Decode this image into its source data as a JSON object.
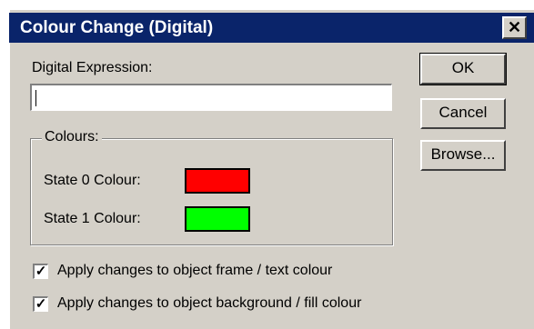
{
  "dialog": {
    "title": "Colour Change (Digital)",
    "close_glyph": "✕",
    "expression_label": "Digital Expression:",
    "expression_value": "",
    "group_label": "Colours:",
    "state0_label": "State 0 Colour:",
    "state0_color": "#ff0000",
    "state1_label": "State 1 Colour:",
    "state1_color": "#00ff00",
    "ok_label": "OK",
    "cancel_label": "Cancel",
    "browse_label": "Browse...",
    "checkbox1_label": "Apply changes to object frame / text colour",
    "checkbox1_checked": true,
    "checkbox2_label": "Apply changes to object background / fill colour",
    "checkbox2_checked": true
  }
}
